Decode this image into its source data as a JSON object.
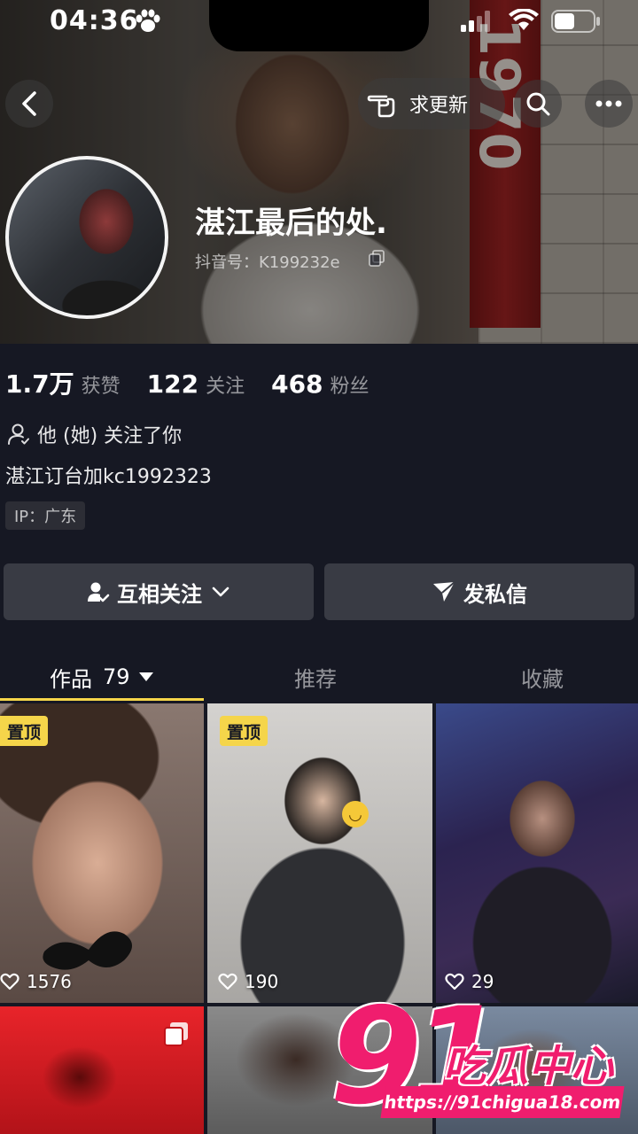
{
  "status_bar": {
    "time": "04:36"
  },
  "header": {
    "request_update_label": "求更新"
  },
  "profile": {
    "display_name": "湛江最后的处.",
    "douyin_id": "抖音号：K199232e",
    "stats": [
      {
        "value": "1.7万",
        "label": "获赞"
      },
      {
        "value": "122",
        "label": "关注"
      },
      {
        "value": "468",
        "label": "粉丝"
      }
    ],
    "follows_you_text": "他 (她) 关注了你",
    "bio": "湛江订台加kc1992323",
    "ip_location": "IP：广东"
  },
  "actions": {
    "mutual_follow_label": "互相关注",
    "message_label": "发私信"
  },
  "tabs": [
    {
      "label": "作品",
      "count": "79",
      "active": true
    },
    {
      "label": "推荐",
      "active": false
    },
    {
      "label": "收藏",
      "active": false
    }
  ],
  "videos": [
    {
      "pinned_label": "置顶",
      "likes": "1576"
    },
    {
      "pinned_label": "置顶",
      "likes": "190"
    },
    {
      "likes": "29"
    },
    {},
    {},
    {}
  ],
  "watermark": {
    "number": "91",
    "name": "吃瓜中心",
    "url": "https://91chigua18.com"
  },
  "colors": {
    "background": "#161823",
    "accent_yellow": "#f5d54a",
    "button_bg": "#393b44",
    "watermark_pink": "#f01d6e"
  }
}
